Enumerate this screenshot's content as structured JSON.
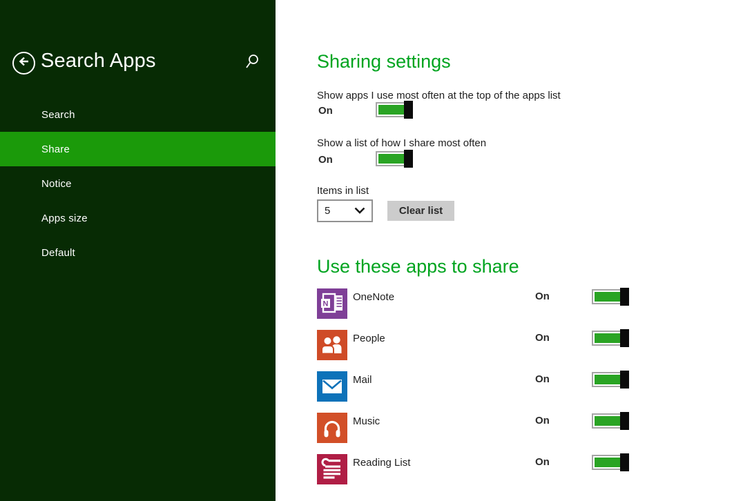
{
  "header": {
    "title": "Search Apps",
    "back_icon": "back-arrow-icon",
    "search_icon": "search-icon"
  },
  "sidebar": {
    "items": [
      {
        "label": "Search",
        "active": false
      },
      {
        "label": "Share",
        "active": true
      },
      {
        "label": "Notice",
        "active": false
      },
      {
        "label": "Apps size",
        "active": false
      },
      {
        "label": "Default",
        "active": false
      }
    ]
  },
  "sharing_settings": {
    "title": "Sharing settings",
    "toggles": [
      {
        "label": "Show apps I use most often at the top of the apps list",
        "state": "On"
      },
      {
        "label": "Show a list of how I share most often",
        "state": "On"
      }
    ],
    "items_in_list": {
      "label": "Items in list",
      "selected_value": "5",
      "chevron_icon": "chevron-down-icon"
    },
    "clear_button_label": "Clear list"
  },
  "share_apps": {
    "title": "Use these apps to share",
    "items": [
      {
        "name": "OneNote",
        "state": "On",
        "icon": "onenote-icon",
        "tile_color": "#7f3f97"
      },
      {
        "name": "People",
        "state": "On",
        "icon": "people-icon",
        "tile_color": "#cf4b27"
      },
      {
        "name": "Mail",
        "state": "On",
        "icon": "mail-icon",
        "tile_color": "#0d72b9"
      },
      {
        "name": "Music",
        "state": "On",
        "icon": "music-icon",
        "tile_color": "#d24f28"
      },
      {
        "name": "Reading List",
        "state": "On",
        "icon": "reading-list-icon",
        "tile_color": "#b01e45"
      }
    ]
  },
  "colors": {
    "sidebar_bg": "#072b04",
    "selected_item_green": "#1b9a0a",
    "heading_green": "#00a41f",
    "toggle_green": "#2aa424",
    "toggle_knob": "#0b0b0b",
    "button_gray": "#cccccc"
  }
}
